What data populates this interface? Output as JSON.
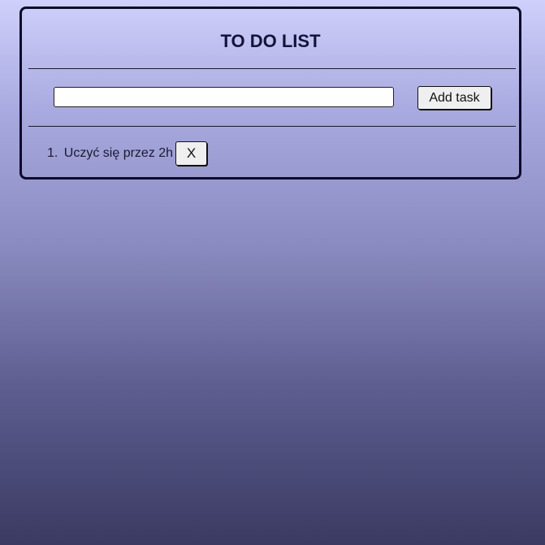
{
  "app": {
    "title": "TO DO LIST"
  },
  "form": {
    "input_value": "",
    "input_placeholder": "",
    "add_button_label": "Add task"
  },
  "tasks": [
    {
      "number_text": "1.",
      "text": "Uczyć się przez 2h",
      "delete_label": "X"
    }
  ],
  "colors": {
    "background_top": "#cfd0fb",
    "background_bottom": "#3a3a62",
    "title": "#14143a",
    "border": "#0c0c2a",
    "button_bg": "#efefef"
  }
}
